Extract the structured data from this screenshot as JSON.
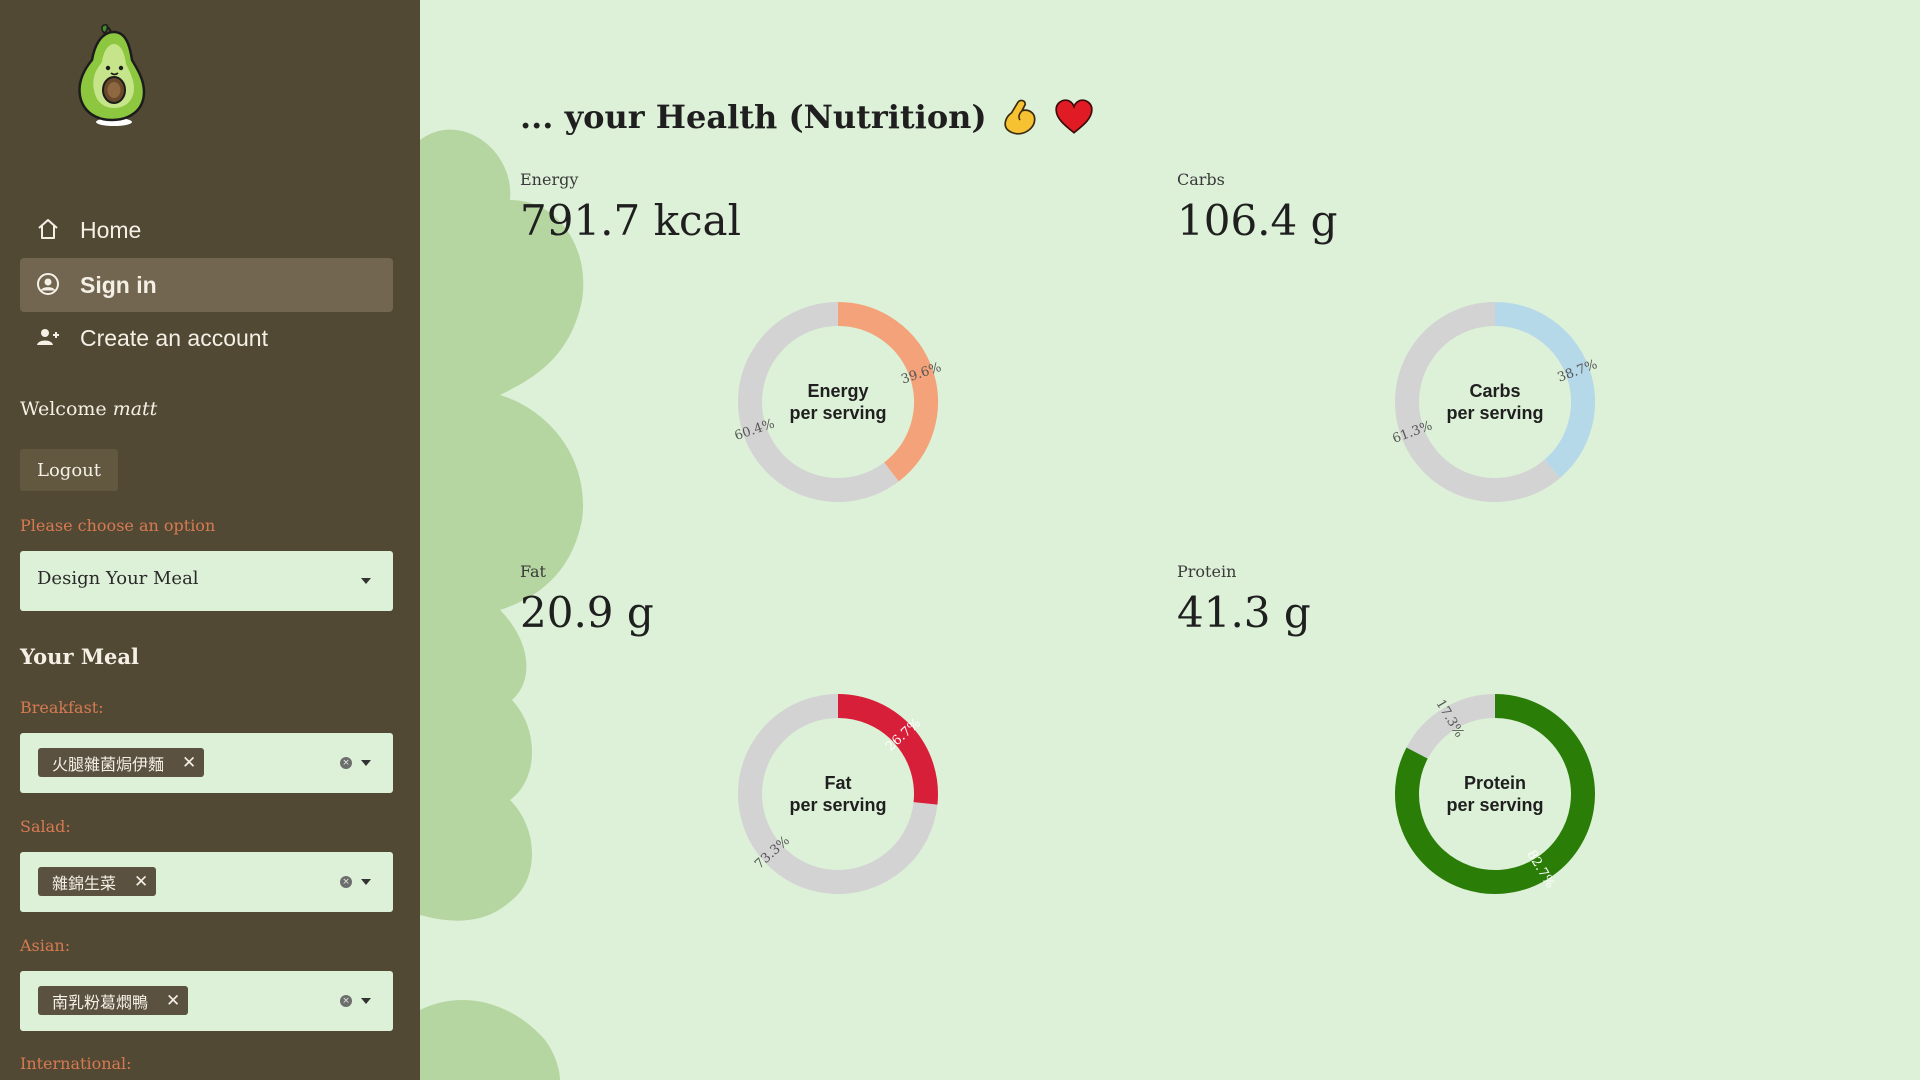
{
  "sidebar": {
    "nav": [
      {
        "label": "Home",
        "icon": "home-icon"
      },
      {
        "label": "Sign in",
        "icon": "user-circle-icon"
      },
      {
        "label": "Create an account",
        "icon": "user-plus-icon"
      }
    ],
    "welcome_prefix": "Welcome ",
    "username": "matt",
    "logout_label": "Logout",
    "choose_label": "Please choose an option",
    "mode_selected": "Design Your Meal",
    "your_meal_heading": "Your Meal",
    "meals": [
      {
        "label": "Breakfast:",
        "selected": "火腿雜菌焗伊麵"
      },
      {
        "label": "Salad:",
        "selected": "雜錦生菜"
      },
      {
        "label": "Asian:",
        "selected": "南乳粉葛燜鴨"
      },
      {
        "label": "International:"
      }
    ],
    "chip_remove_glyph": "✕",
    "clear_glyph": "×"
  },
  "main": {
    "title": "... your Health (Nutrition)",
    "title_emojis": [
      "flexed-biceps-icon",
      "red-heart-icon"
    ],
    "metrics": [
      {
        "name": "Energy",
        "value": "791.7 kcal",
        "center_line1": "Energy",
        "center_line2": "per serving",
        "pct_value": 39.6,
        "pct_rest": 60.4,
        "pct_value_label": "39.6%",
        "pct_rest_label": "60.4%",
        "color": "#f4a27a"
      },
      {
        "name": "Carbs",
        "value": "106.4 g",
        "center_line1": "Carbs",
        "center_line2": "per serving",
        "pct_value": 38.7,
        "pct_rest": 61.3,
        "pct_value_label": "38.7%",
        "pct_rest_label": "61.3%",
        "color": "#b5d9e8"
      },
      {
        "name": "Fat",
        "value": "20.9 g",
        "center_line1": "Fat",
        "center_line2": "per serving",
        "pct_value": 26.7,
        "pct_rest": 73.3,
        "pct_value_label": "26.7%",
        "pct_rest_label": "73.3%",
        "color": "#d81f3a"
      },
      {
        "name": "Protein",
        "value": "41.3 g",
        "center_line1": "Protein",
        "center_line2": "per serving",
        "pct_value": 82.7,
        "pct_rest": 17.3,
        "pct_value_label": "82.7%",
        "pct_rest_label": "17.3%",
        "color": "#2a7d06"
      }
    ],
    "rest_color": "#d3d3d3"
  }
}
